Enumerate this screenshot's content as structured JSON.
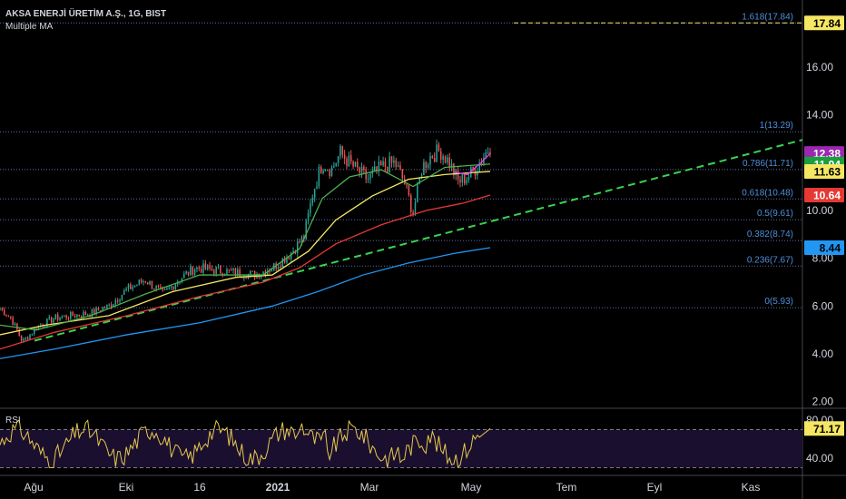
{
  "header": {
    "title": "AKSA ENERJİ ÜRETİM A.Ş., 1G, BIST",
    "indicator": "Multiple MA"
  },
  "rsi": {
    "label": "RSI",
    "value_badge": "71.17",
    "ticks": [
      "80.00",
      "40.00"
    ],
    "levels": [
      70,
      30
    ]
  },
  "chart_data": {
    "type": "candlestick",
    "x_ticks": [
      "Ağu",
      "Eki",
      "16",
      "2021",
      "Mar",
      "May",
      "Tem",
      "Eyl",
      "Kas"
    ],
    "y_ticks": [
      "2.00",
      "4.00",
      "6.00",
      "8.00",
      "10.00",
      "12.00",
      "14.00",
      "16.00"
    ],
    "ylim": [
      1.8,
      18.8
    ],
    "fib_levels": [
      {
        "label": "1.618(17.84)",
        "value": 17.84
      },
      {
        "label": "1(13.29)",
        "value": 13.29
      },
      {
        "label": "0.786(11.71)",
        "value": 11.71
      },
      {
        "label": "0.618(10.48)",
        "value": 10.48
      },
      {
        "label": "0.5(9.61)",
        "value": 9.61
      },
      {
        "label": "0.382(8.74)",
        "value": 8.74
      },
      {
        "label": "0.236(7.67)",
        "value": 7.67
      },
      {
        "label": "0(5.93)",
        "value": 5.93
      }
    ],
    "price_badges": [
      {
        "text": "17.84",
        "value": 17.84,
        "bg": "#f5e663",
        "fg": "#000000"
      },
      {
        "text": "12.38",
        "value": 12.38,
        "bg": "#9c27b0",
        "fg": "#ffffff"
      },
      {
        "text": "11.94",
        "value": 11.94,
        "bg": "#1b9e3e",
        "fg": "#ffffff"
      },
      {
        "text": "11.63",
        "value": 11.63,
        "bg": "#f5e663",
        "fg": "#000000"
      },
      {
        "text": "10.64",
        "value": 10.64,
        "bg": "#e53935",
        "fg": "#ffffff"
      },
      {
        "text": "8.44",
        "value": 8.44,
        "bg": "#2196f3",
        "fg": "#000000"
      }
    ],
    "colors": {
      "up": "#26a69a",
      "down": "#ef5350",
      "grid": "#2a2e39",
      "fib": "#5b6fa8",
      "ma_fast": "#e040fb",
      "ma_green": "#4caf50",
      "ma_yellow": "#f5e663",
      "ma_red": "#e53935",
      "ma_blue": "#2196f3",
      "trend": "#39d353",
      "rsi_line": "#e6c84e"
    }
  }
}
